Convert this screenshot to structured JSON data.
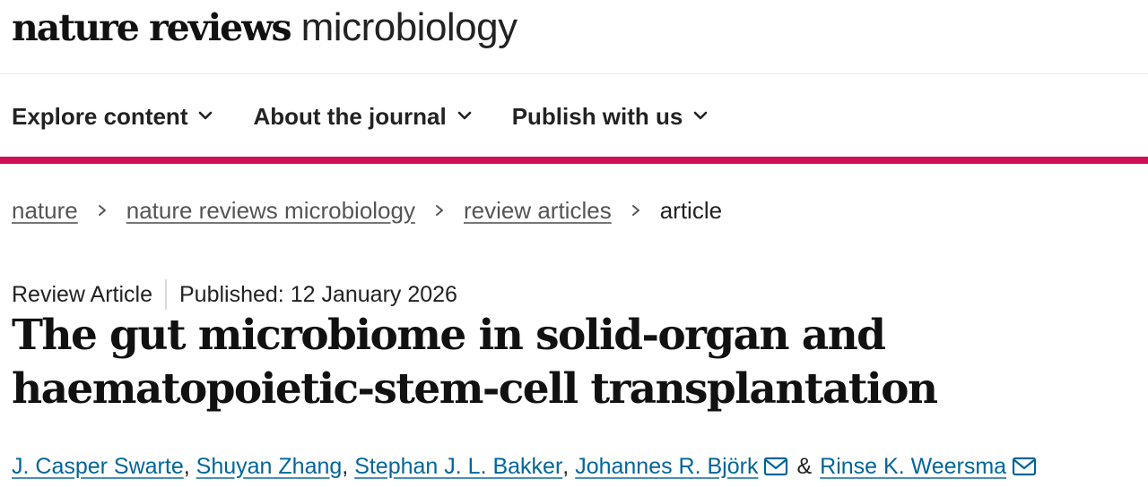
{
  "brand": {
    "logo_bold": "nature reviews",
    "logo_light": "microbiology"
  },
  "nav": {
    "items": [
      {
        "label": "Explore content",
        "icon": "chevron-down-icon"
      },
      {
        "label": "About the journal",
        "icon": "chevron-down-icon"
      },
      {
        "label": "Publish with us",
        "icon": "chevron-down-icon"
      }
    ]
  },
  "breadcrumb": {
    "links": [
      "nature",
      "nature reviews microbiology",
      "review articles"
    ],
    "current": "article",
    "separator_icon": "chevron-right-icon"
  },
  "article": {
    "type": "Review Article",
    "published": "Published: 12 January 2026",
    "title": "The gut microbiome in solid-organ and haematopoietic-stem-cell transplantation",
    "authors": [
      {
        "name": "J. Casper Swarte",
        "corresponding": false
      },
      {
        "name": "Shuyan Zhang",
        "corresponding": false
      },
      {
        "name": "Stephan J. L. Bakker",
        "corresponding": false
      },
      {
        "name": "Johannes R. Björk",
        "corresponding": true
      },
      {
        "name": "Rinse K. Weersma",
        "corresponding": true
      }
    ],
    "author_separator": ",",
    "author_conjunction": "&"
  },
  "colors": {
    "accent": "#d10f57",
    "link": "#006699",
    "text": "#222222"
  }
}
